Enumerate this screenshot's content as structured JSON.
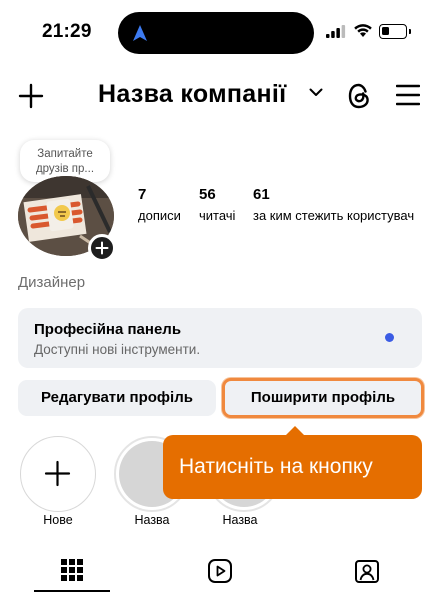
{
  "status_bar": {
    "time": "21:29"
  },
  "header": {
    "account_name": "Назва компанії"
  },
  "note": {
    "line1": "Запитайте",
    "line2": "друзів пр..."
  },
  "stats": [
    {
      "value": "7",
      "label": "дописи"
    },
    {
      "value": "56",
      "label": "читачі"
    },
    {
      "value": "61",
      "label": "за ким стежить користувач"
    }
  ],
  "category": "Дизайнер",
  "pro_panel": {
    "title": "Професійна панель",
    "subtitle": "Доступні нові інструменти."
  },
  "buttons": {
    "edit": "Редагувати профіль",
    "share": "Поширити профіль"
  },
  "tooltip": {
    "text": "Натисніть на кнопку"
  },
  "highlights": [
    {
      "label": "Нове"
    },
    {
      "label": "Назва"
    },
    {
      "label": "Назва"
    }
  ],
  "colors": {
    "accent": "#e56e00",
    "highlight_border": "#f0893e",
    "notification_dot": "#3b5ce4",
    "panel_bg": "#eff1f4"
  },
  "tabs": [
    {
      "icon": "grid-icon",
      "active": true
    },
    {
      "icon": "reels-icon",
      "active": false
    },
    {
      "icon": "tagged-icon",
      "active": false
    }
  ]
}
